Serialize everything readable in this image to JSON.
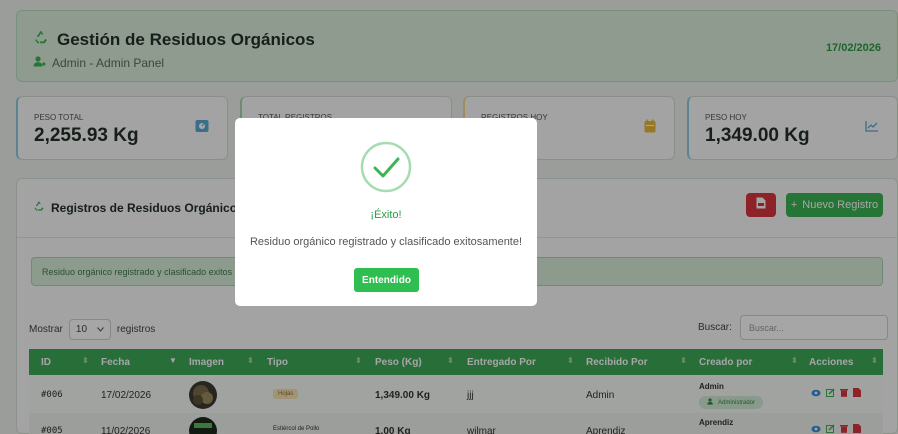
{
  "header": {
    "title": "Gestión de Residuos Orgánicos",
    "subtitle": "Admin - Admin Panel",
    "date": "17/02/2026"
  },
  "stats": [
    {
      "label": "PESO TOTAL",
      "value": "2,255.93 Kg",
      "icon": "scale-icon"
    },
    {
      "label": "TOTAL REGISTROS",
      "value": "",
      "icon": "list-icon"
    },
    {
      "label": "REGISTROS HOY",
      "value": "",
      "icon": "calendar-icon"
    },
    {
      "label": "PESO HOY",
      "value": "1,349.00 Kg",
      "icon": "chart-line-icon"
    }
  ],
  "panel": {
    "title": "Registros de Residuos Orgánicos",
    "new_button": "Nuevo Registro",
    "alert": "Residuo orgánico registrado y clasificado exitos",
    "show_label": "Mostrar",
    "show_value": "10",
    "records_label": "registros",
    "search_label": "Buscar:",
    "search_placeholder": "Buscar..."
  },
  "table": {
    "headers": [
      "ID",
      "Fecha",
      "Imagen",
      "Tipo",
      "Peso (Kg)",
      "Entregado Por",
      "Recibido Por",
      "Creado por",
      "Acciones"
    ],
    "rows": [
      {
        "id": "#006",
        "fecha": "17/02/2026",
        "tipo": "Hojas",
        "peso": "1,349.00 Kg",
        "entregado": "jjj",
        "recibido": "Admin",
        "creado": "Admin",
        "rol": "Administrador"
      },
      {
        "id": "#005",
        "fecha": "11/02/2026",
        "tipo": "Estiércol de Pollo",
        "peso": "1.00 Kg",
        "entregado": "wilmar",
        "recibido": "Aprendiz",
        "creado": "Aprendiz",
        "rol": ""
      }
    ]
  },
  "modal": {
    "title": "¡Éxito!",
    "message": "Residuo orgánico registrado y clasificado exitosamente!",
    "button": "Entendido"
  },
  "colors": {
    "primary_green": "#3ea956",
    "success_green": "#2fbf50",
    "danger_red": "#d9363e",
    "date_green": "#2e9c45"
  }
}
